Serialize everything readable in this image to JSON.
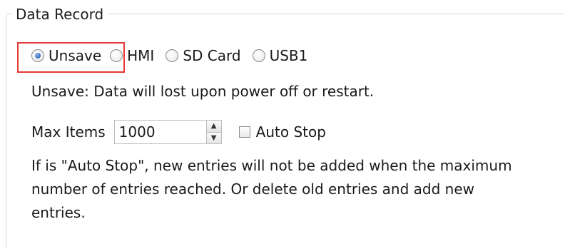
{
  "group": {
    "title": "Data Record"
  },
  "storage": {
    "options": [
      {
        "label": "Unsave",
        "checked": true
      },
      {
        "label": "HMI",
        "checked": false
      },
      {
        "label": "SD Card",
        "checked": false
      },
      {
        "label": "USB1",
        "checked": false
      }
    ],
    "highlight_color": "#e53935"
  },
  "unsave_note": "Unsave: Data will lost upon power off or restart.",
  "max_items": {
    "label": "Max Items",
    "value": "1000"
  },
  "auto_stop": {
    "label": "Auto Stop",
    "checked": false
  },
  "description": "If is \"Auto Stop\", new entries will not be added when the maximum number of entries reached. Or delete old entries and add new entries.",
  "colors": {
    "radio_selected": "#3c74c8",
    "group_border": "#d9d9d9"
  },
  "icons": {
    "spin_up": "▲",
    "spin_down": "▼"
  }
}
